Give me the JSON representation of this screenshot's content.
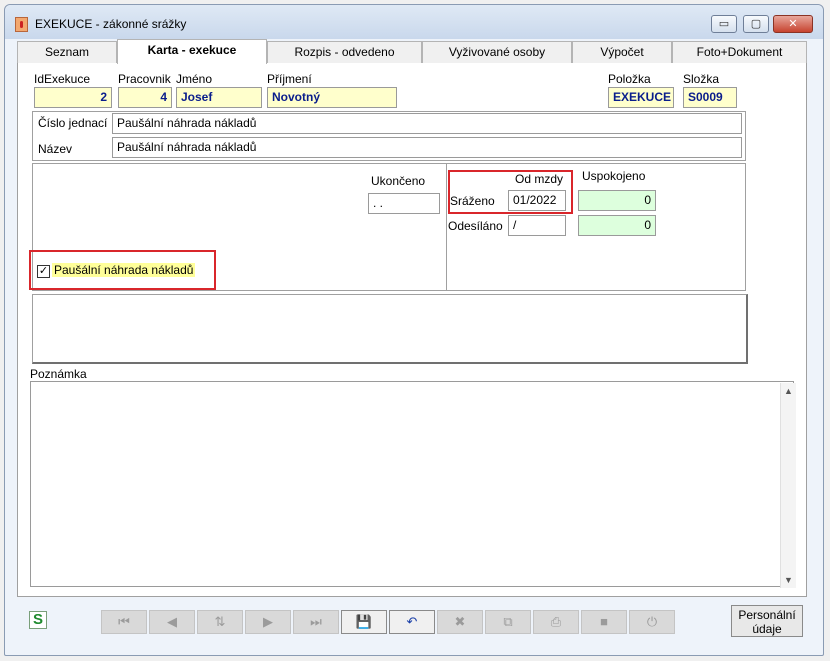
{
  "window": {
    "title": "EXEKUCE - zákonné srážky",
    "minimize": "▭",
    "maximize": "▢",
    "close": "✕"
  },
  "tabs": [
    {
      "label": "Seznam",
      "active": false
    },
    {
      "label": "Karta - exekuce",
      "active": true
    },
    {
      "label": "Rozpis - odvedeno",
      "active": false
    },
    {
      "label": "Vyživované osoby",
      "active": false
    },
    {
      "label": "Výpočet",
      "active": false
    },
    {
      "label": "Foto+Dokument",
      "active": false
    }
  ],
  "header": {
    "idexekuce_label": "IdExekuce",
    "idexekuce_value": "2",
    "pracovnik_label": "Pracovnik",
    "pracovnik_value": "4",
    "jmeno_label": "Jméno",
    "jmeno_value": "Josef",
    "prijmeni_label": "Příjmení",
    "prijmeni_value": "Novotný",
    "polozka_label": "Položka",
    "polozka_value": "EXEKUCE",
    "slozka_label": "Složka",
    "slozka_value": "S0009"
  },
  "info": {
    "cislo_jednaci_label": "Číslo jednací",
    "cislo_jednaci_value": "Paušální náhrada nákladů",
    "nazev_label": "Název",
    "nazev_value": "Paušální náhrada nákladů"
  },
  "details": {
    "ukonceno_label": "Ukončeno",
    "ukonceno_value": ". .",
    "od_mzdy_label": "Od mzdy",
    "uspokojeno_label": "Uspokojeno",
    "srazeno_label": "Sráženo",
    "srazeno_value": "01/2022",
    "srazeno_uspokojeno": "0",
    "odesilano_label": "Odesíláno",
    "odesilano_value": "/",
    "odesilano_uspokojeno": "0",
    "checkbox_label": "Paušální náhrada nákladů",
    "checkbox_checked": true,
    "checkbox_mark": "✓"
  },
  "note": {
    "label": "Poznámka",
    "value": ""
  },
  "toolbar": {
    "first": "⏮",
    "prev": "◀",
    "sort": "⇅",
    "next": "▶",
    "last": "⏭",
    "save": "💾",
    "undo": "↶",
    "delete": "✖",
    "copy": "⧉",
    "print": "⎙",
    "stop": "■",
    "power": "⏻",
    "personal_line1": "Personální",
    "personal_line2": "údaje",
    "app_logo": "S"
  }
}
